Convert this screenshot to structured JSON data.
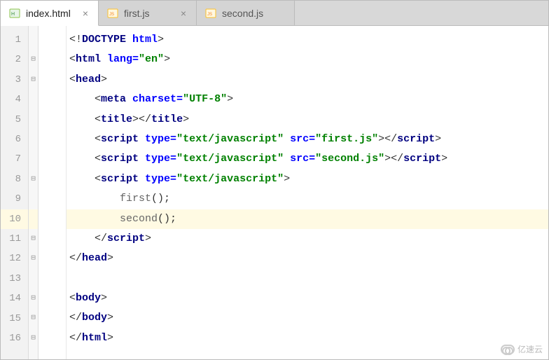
{
  "tabs": [
    {
      "label": "index.html",
      "icon": "html-icon",
      "active": true,
      "closable": true
    },
    {
      "label": "first.js",
      "icon": "js-icon",
      "active": false,
      "closable": true
    },
    {
      "label": "second.js",
      "icon": "js-icon",
      "active": false,
      "closable": false
    }
  ],
  "gutter": [
    "1",
    "2",
    "3",
    "4",
    "5",
    "6",
    "7",
    "8",
    "9",
    "10",
    "11",
    "12",
    "13",
    "14",
    "15",
    "16"
  ],
  "fold": [
    "",
    "⊟",
    "⊟",
    "",
    "",
    "",
    "",
    "⊟",
    "",
    "",
    "⊟",
    "⊟",
    "",
    "⊟",
    "⊟",
    "⊟"
  ],
  "caret_line_index": 9,
  "code_lines": [
    {
      "tokens": [
        [
          "punc",
          "<!"
        ],
        [
          "tag",
          "DOCTYPE "
        ],
        [
          "attr",
          "html"
        ],
        [
          "punc",
          ">"
        ]
      ],
      "indent": 0
    },
    {
      "tokens": [
        [
          "punc",
          "<"
        ],
        [
          "tag",
          "html "
        ],
        [
          "attr",
          "lang="
        ],
        [
          "str",
          "\"en\""
        ],
        [
          "punc",
          ">"
        ]
      ],
      "indent": 0
    },
    {
      "tokens": [
        [
          "punc",
          "<"
        ],
        [
          "tag",
          "head"
        ],
        [
          "punc",
          ">"
        ]
      ],
      "indent": 0
    },
    {
      "tokens": [
        [
          "punc",
          "<"
        ],
        [
          "tag",
          "meta "
        ],
        [
          "attr",
          "charset="
        ],
        [
          "str",
          "\"UTF-8\""
        ],
        [
          "punc",
          ">"
        ]
      ],
      "indent": 1
    },
    {
      "tokens": [
        [
          "punc",
          "<"
        ],
        [
          "tag",
          "title"
        ],
        [
          "punc",
          "></"
        ],
        [
          "tag",
          "title"
        ],
        [
          "punc",
          ">"
        ]
      ],
      "indent": 1
    },
    {
      "tokens": [
        [
          "punc",
          "<"
        ],
        [
          "tag",
          "script "
        ],
        [
          "attr",
          "type="
        ],
        [
          "str",
          "\"text/javascript\" "
        ],
        [
          "attr",
          "src="
        ],
        [
          "str",
          "\"first.js\""
        ],
        [
          "punc",
          "></"
        ],
        [
          "tag",
          "script"
        ],
        [
          "punc",
          ">"
        ]
      ],
      "indent": 1
    },
    {
      "tokens": [
        [
          "punc",
          "<"
        ],
        [
          "tag",
          "script "
        ],
        [
          "attr",
          "type="
        ],
        [
          "str",
          "\"text/javascript\" "
        ],
        [
          "attr",
          "src="
        ],
        [
          "str",
          "\"second.js\""
        ],
        [
          "punc",
          "></"
        ],
        [
          "tag",
          "script"
        ],
        [
          "punc",
          ">"
        ]
      ],
      "indent": 1
    },
    {
      "tokens": [
        [
          "punc",
          "<"
        ],
        [
          "tag",
          "script "
        ],
        [
          "attr",
          "type="
        ],
        [
          "str",
          "\"text/javascript\""
        ],
        [
          "punc",
          ">"
        ]
      ],
      "indent": 1
    },
    {
      "tokens": [
        [
          "func",
          "first"
        ],
        [
          "punc",
          "();"
        ]
      ],
      "indent": 2
    },
    {
      "tokens": [
        [
          "func",
          "second"
        ],
        [
          "punc",
          "();"
        ]
      ],
      "indent": 2
    },
    {
      "tokens": [
        [
          "punc",
          "</"
        ],
        [
          "tag",
          "script"
        ],
        [
          "punc",
          ">"
        ]
      ],
      "indent": 1
    },
    {
      "tokens": [
        [
          "punc",
          "</"
        ],
        [
          "tag",
          "head"
        ],
        [
          "punc",
          ">"
        ]
      ],
      "indent": 0
    },
    {
      "tokens": [],
      "indent": 0
    },
    {
      "tokens": [
        [
          "punc",
          "<"
        ],
        [
          "tag",
          "body"
        ],
        [
          "punc",
          ">"
        ]
      ],
      "indent": 0
    },
    {
      "tokens": [
        [
          "punc",
          "</"
        ],
        [
          "tag",
          "body"
        ],
        [
          "punc",
          ">"
        ]
      ],
      "indent": 0
    },
    {
      "tokens": [
        [
          "punc",
          "</"
        ],
        [
          "tag",
          "html"
        ],
        [
          "punc",
          ">"
        ]
      ],
      "indent": 0
    }
  ],
  "watermark": "亿速云"
}
